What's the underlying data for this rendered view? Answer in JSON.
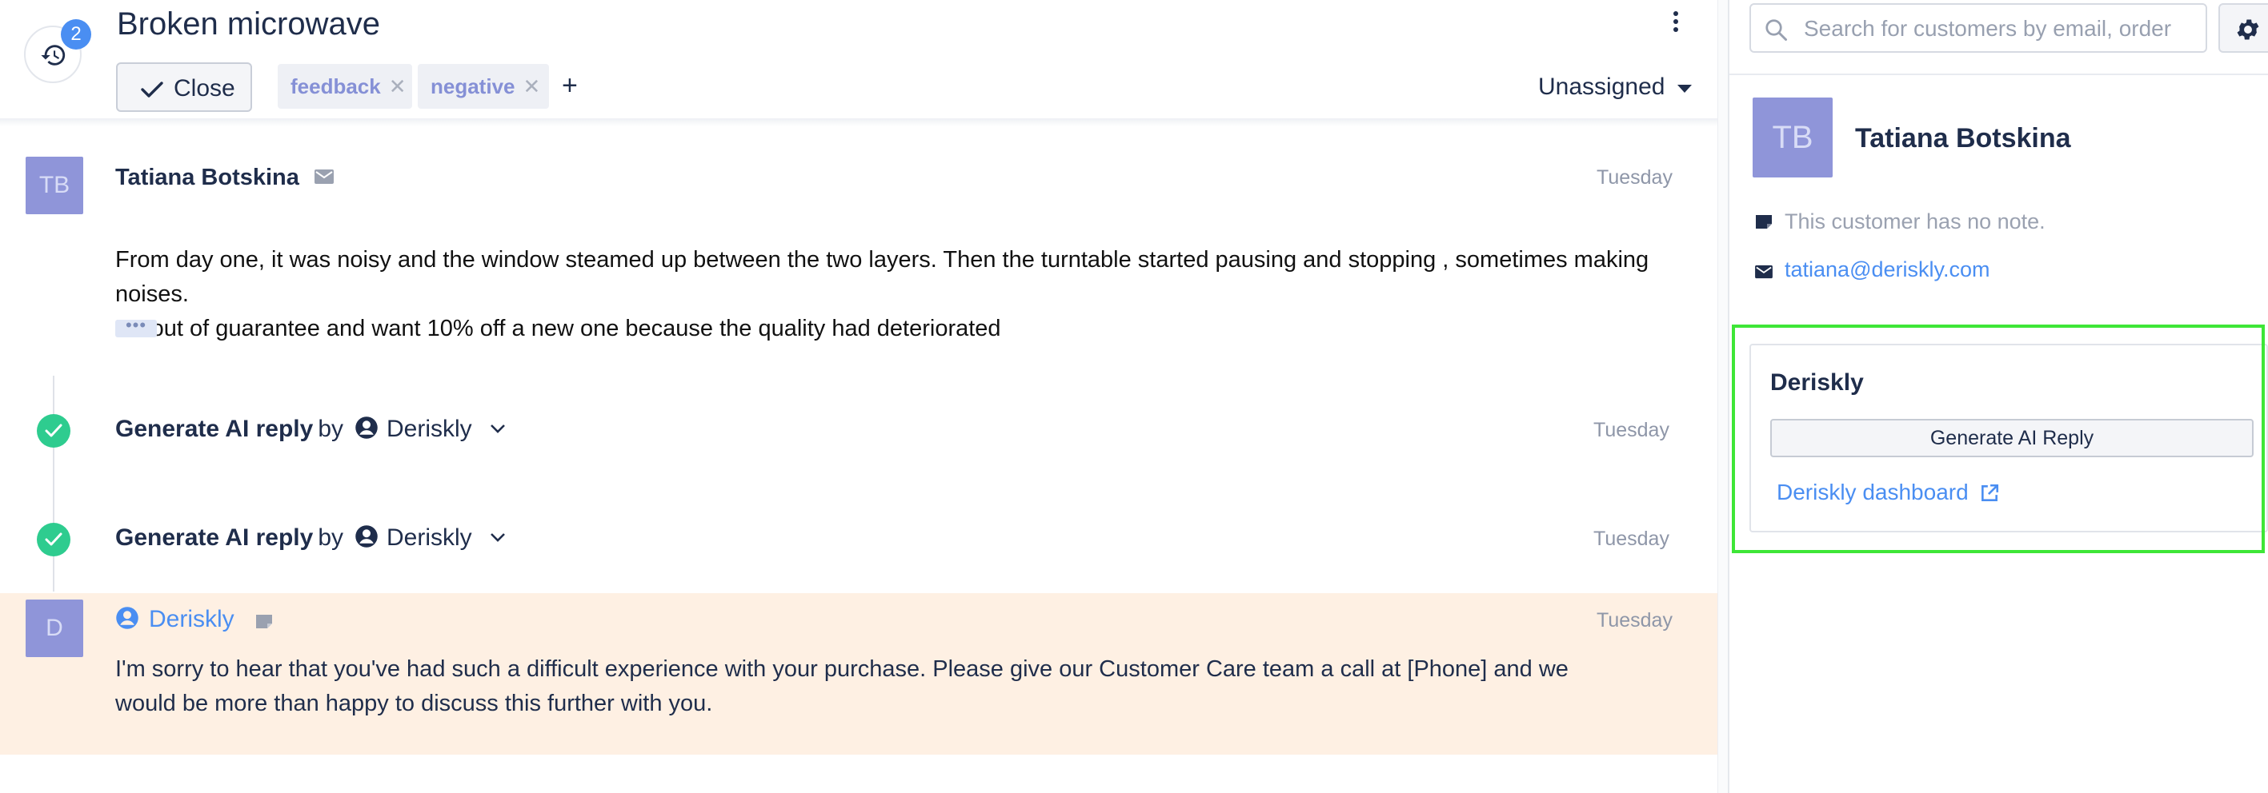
{
  "conversation": {
    "title": "Broken microwave",
    "history_count": "2",
    "close_label": "Close",
    "tags": [
      {
        "label": "feedback"
      },
      {
        "label": "negative"
      }
    ],
    "add_tag_label": "+",
    "assignee": "Unassigned"
  },
  "messages": [
    {
      "avatar_initials": "TB",
      "author": "Tatiana Botskina",
      "time": "Tuesday",
      "body_line1": "From day one, it was noisy and the window steamed up between the two layers. Then the turntable started pausing and stopping , sometimes making noises.",
      "body_line2": "It’s out of guarantee and want 10% off a new one because the quality had deteriorated",
      "more_label": "•••"
    }
  ],
  "events": [
    {
      "action": "Generate AI reply",
      "by": "by",
      "actor": "Deriskly",
      "time": "Tuesday"
    },
    {
      "action": "Generate AI reply",
      "by": "by",
      "actor": "Deriskly",
      "time": "Tuesday"
    }
  ],
  "reply": {
    "avatar_initials": "D",
    "author": "Deriskly",
    "time": "Tuesday",
    "body_line1": "I'm sorry to hear that you've had such a difficult experience with your purchase. Please give our Customer Care team a call at [Phone] and we",
    "body_line2": "would be more than happy to discuss this further with you."
  },
  "sidebar": {
    "search_placeholder": "Search for customers by email, order",
    "customer": {
      "avatar_initials": "TB",
      "name": "Tatiana Botskina",
      "note": "This customer has no note.",
      "email": "tatiana@deriskly.com"
    },
    "widget": {
      "title": "Deriskly",
      "button_label": "Generate AI Reply",
      "dashboard_link": "Deriskly dashboard"
    }
  },
  "colors": {
    "accent": "#4a8ef2",
    "avatar": "#8f95d9",
    "success": "#2ecc8f",
    "reply_bg": "#fef0e3",
    "highlight": "#3ee637",
    "text": "#1f2d4b"
  }
}
